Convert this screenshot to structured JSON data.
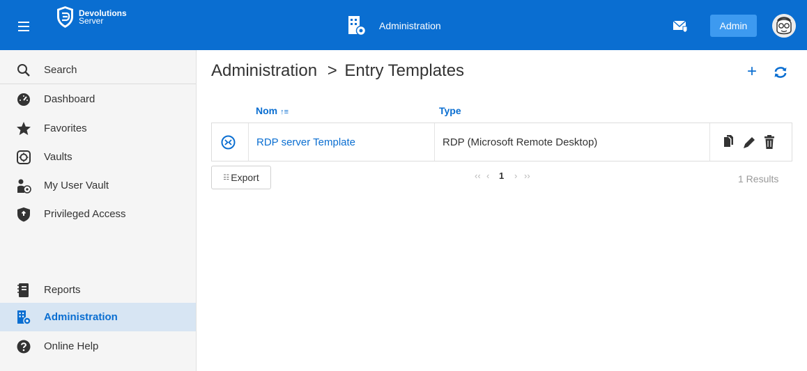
{
  "brand": {
    "name_line1": "Devolutions",
    "name_line2": "Server"
  },
  "header": {
    "section_title": "Administration",
    "admin_label": "Admin"
  },
  "sidebar": {
    "items": [
      {
        "label": "Search"
      },
      {
        "label": "Dashboard"
      },
      {
        "label": "Favorites"
      },
      {
        "label": "Vaults"
      },
      {
        "label": "My User Vault"
      },
      {
        "label": "Privileged Access"
      },
      {
        "label": "Reports"
      },
      {
        "label": "Administration"
      },
      {
        "label": "Online Help"
      }
    ],
    "active_index": 7
  },
  "breadcrumb": {
    "parent": "Administration",
    "separator": ">",
    "current": "Entry Templates"
  },
  "table": {
    "columns": {
      "name": "Nom",
      "type": "Type"
    },
    "rows": [
      {
        "name": "RDP server Template",
        "type": "RDP (Microsoft Remote Desktop)"
      }
    ]
  },
  "footer": {
    "export_label": "Export",
    "pagination": {
      "first": "‹‹",
      "prev": "‹",
      "current_page": "1",
      "next": "›",
      "last": "››"
    },
    "results": "1 Results"
  },
  "colors": {
    "primary": "#0a6ed1",
    "topbar": "#0a6ed1",
    "admin_button": "#3d9af0",
    "active_nav_bg": "#d7e5f3"
  },
  "icons": [
    "menu-icon",
    "devolutions-logo-icon",
    "administration-icon",
    "message-icon",
    "avatar",
    "search-icon",
    "dashboard-icon",
    "star-icon",
    "vault-icon",
    "user-vault-icon",
    "shield-icon",
    "reports-icon",
    "help-icon",
    "add-icon",
    "refresh-icon",
    "sort-icon",
    "rdp-icon",
    "copy-icon",
    "edit-icon",
    "delete-icon"
  ]
}
